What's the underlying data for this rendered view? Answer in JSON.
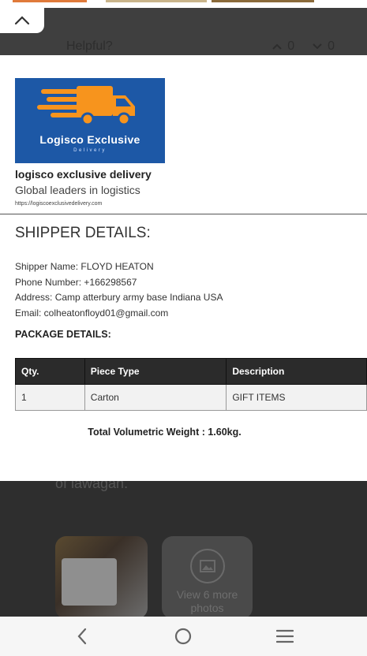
{
  "background": {
    "helpful_label": "Helpful?",
    "upvote_count": "0",
    "downvote_count": "0",
    "partial_text": "of lawagan.",
    "more_photos_label": "View 6 more photos"
  },
  "card": {
    "logo": {
      "title": "Logisco Exclusive",
      "subtitle": "Delivery"
    },
    "company_name": "logisco exclusive delivery",
    "tagline": "Global leaders in logistics",
    "url": "https://logiscoexclusivedelivery.com",
    "section_title": "SHIPPER DETAILS:",
    "shipper": {
      "name_line": "Shipper Name: FLOYD HEATON",
      "phone_line": "Phone Number: +166298567",
      "address_line": "Address: Camp atterbury army base Indiana USA",
      "email_line": "Email: colheatonfloyd01@gmail.com"
    },
    "package_title": "PACKAGE DETAILS:",
    "table": {
      "headers": [
        "Qty.",
        "Piece Type",
        "Description"
      ],
      "rows": [
        [
          "1",
          "Carton",
          "GIFT ITEMS"
        ]
      ]
    },
    "total_weight": "Total Volumetric Weight : 1.60kg."
  },
  "colors": {
    "logo_bg": "#1d58a6",
    "logo_truck": "#f7941d",
    "table_header_bg": "#2b2b2b"
  },
  "icons": [
    "chevron-up-icon",
    "thumbs-up-icon",
    "thumbs-down-icon",
    "image-icon",
    "back-icon",
    "home-icon",
    "menu-icon"
  ]
}
